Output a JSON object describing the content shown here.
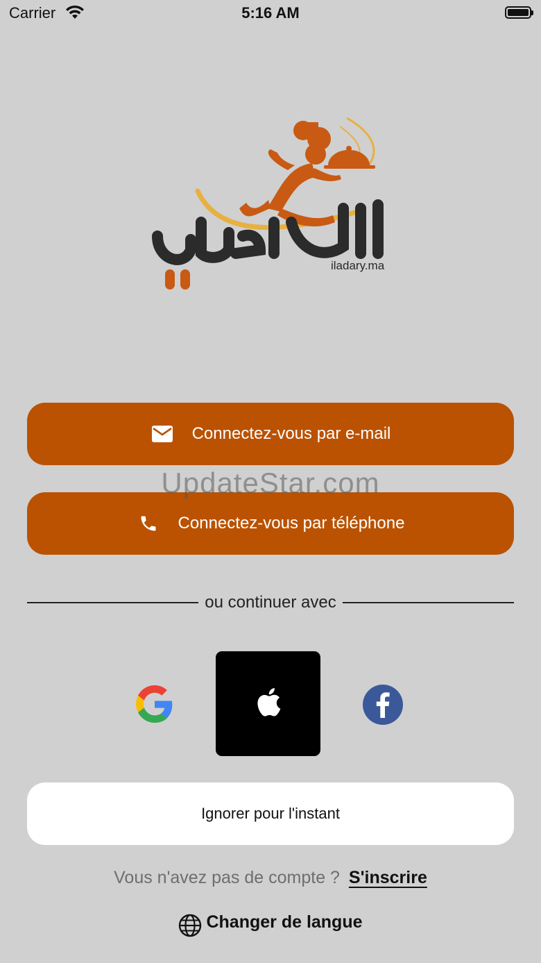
{
  "status_bar": {
    "carrier": "Carrier",
    "time": "5:16 AM",
    "icons": [
      "wifi-icon",
      "battery-icon"
    ]
  },
  "logo": {
    "caption": "iladary.ma",
    "colors": {
      "orange": "#c85a14",
      "yellow": "#e8b040",
      "dark": "#2b2b2b"
    }
  },
  "login": {
    "email_button": {
      "label": "Connectez-vous par e-mail",
      "icon": "mail-icon"
    },
    "phone_button": {
      "label": "Connectez-vous par téléphone",
      "icon": "phone-icon"
    }
  },
  "watermark": "UpdateStar.com",
  "divider": {
    "text": "ou continuer avec"
  },
  "social": {
    "providers": [
      "google-icon",
      "apple-icon",
      "facebook-icon"
    ]
  },
  "skip_button": {
    "label": "Ignorer pour l'instant"
  },
  "signup": {
    "prompt": "Vous n'avez pas de compte ?",
    "link": "S'inscrire"
  },
  "language": {
    "label": "Changer de langue",
    "icon": "globe-icon"
  },
  "colors": {
    "background": "#d0d0d1",
    "accent": "#ba5202",
    "apple_button": "#000000",
    "facebook": "#3b5998"
  }
}
